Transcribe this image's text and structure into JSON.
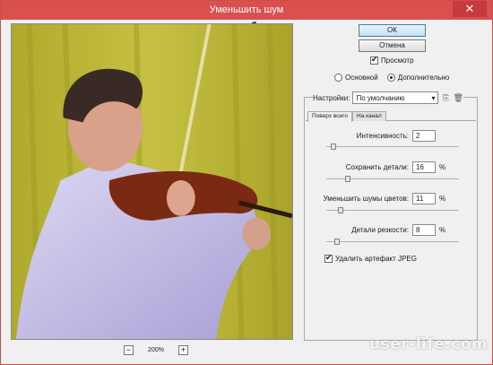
{
  "window": {
    "title": "Уменьшить шум",
    "close_glyph": "✕"
  },
  "buttons": {
    "ok": "ОК",
    "cancel": "Отмена"
  },
  "preview_toggle": {
    "label": "Просмотр",
    "checked": true
  },
  "mode": {
    "options": [
      "Основной",
      "Дополнительно"
    ],
    "selected": "Дополнительно"
  },
  "settings": {
    "label": "Настройки:",
    "value": "По умолчанию",
    "icons": [
      "save-preset-icon",
      "delete-preset-icon"
    ]
  },
  "tabs": [
    "Поверх всего",
    "На канал"
  ],
  "fields": {
    "intensity": {
      "label": "Интенсивность:",
      "value": "2",
      "unit": "",
      "slider": 0.2
    },
    "preserve": {
      "label": "Сохранить детали:",
      "value": "16",
      "unit": "%",
      "slider": 0.16
    },
    "color_noise": {
      "label": "Уменьшить шумы цветов:",
      "value": "11",
      "unit": "%",
      "slider": 0.11
    },
    "sharpen": {
      "label": "Детали резкости:",
      "value": "8",
      "unit": "%",
      "slider": 0.08
    }
  },
  "jpeg": {
    "label": "Удалить артефакт JPEG",
    "checked": true
  },
  "zoom": {
    "minus": "−",
    "value": "200%",
    "plus": "+"
  },
  "watermark": "user-life.com"
}
